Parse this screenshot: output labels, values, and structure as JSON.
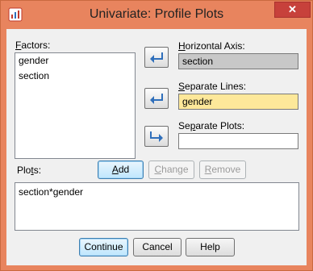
{
  "window": {
    "title": "Univariate: Profile Plots",
    "close_glyph": "✕"
  },
  "factors": {
    "label": "Factors:",
    "items": [
      "gender",
      "section"
    ]
  },
  "horizontal_axis": {
    "label": "Horizontal Axis:",
    "value": "section"
  },
  "separate_lines": {
    "label": "Separate Lines:",
    "value": "gender"
  },
  "separate_plots": {
    "label": "Separate Plots:",
    "value": ""
  },
  "plots": {
    "label": "Plots:",
    "add_label": "Add",
    "change_label": "Change",
    "remove_label": "Remove",
    "items": [
      "section*gender"
    ]
  },
  "buttons": {
    "continue": "Continue",
    "cancel": "Cancel",
    "help": "Help"
  },
  "colors": {
    "title_bar": "#e8845e",
    "close_button": "#c7413b",
    "arrow_icon": "#2f6fbb",
    "highlight_field": "#fde89a",
    "readonly_field": "#c8c8c8"
  }
}
